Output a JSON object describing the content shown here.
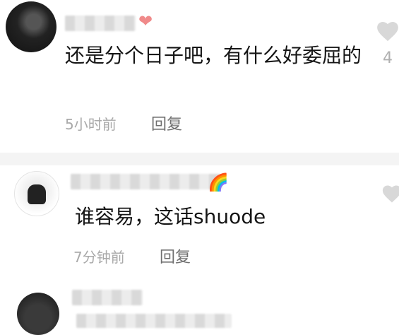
{
  "comments": [
    {
      "text": "还是分个日子吧，有什么好委屈的",
      "time": "5小时前",
      "reply_label": "回复",
      "like_count": "4",
      "name_emoji": "❤"
    },
    {
      "text": "谁容易，这话shuode",
      "time": "7分钟前",
      "reply_label": "回复",
      "name_emoji": "🌈"
    }
  ],
  "colors": {
    "heart_pink": "#f08a8a",
    "like_gray": "#d8d8d8",
    "divider": "#f4f4f4"
  }
}
